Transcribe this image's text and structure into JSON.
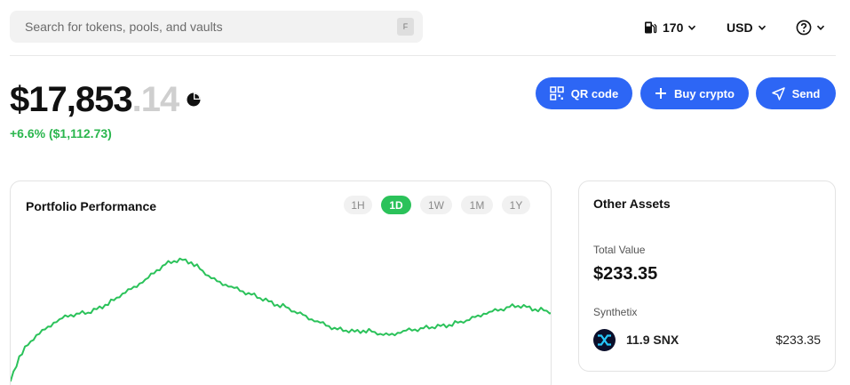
{
  "search": {
    "placeholder": "Search for tokens, pools, and vaults",
    "shortcut": "F"
  },
  "header": {
    "gas_value": "170",
    "currency": "USD"
  },
  "balance": {
    "whole": "$17,853",
    "cents": ".14",
    "change": "+6.6% ($1,112.73)",
    "change_color": "#2bb64e"
  },
  "actions": {
    "qr_label": "QR code",
    "buy_label": "Buy crypto",
    "send_label": "Send",
    "button_color": "#2d66f5"
  },
  "performance": {
    "title": "Portfolio Performance",
    "tabs": [
      {
        "label": "1H",
        "active": false
      },
      {
        "label": "1D",
        "active": true
      },
      {
        "label": "1W",
        "active": false
      },
      {
        "label": "1M",
        "active": false
      },
      {
        "label": "1Y",
        "active": false
      }
    ],
    "series_values": [
      6,
      28,
      38,
      47,
      52,
      58,
      62,
      65,
      66,
      67,
      70,
      74,
      78,
      84,
      88,
      93,
      98,
      105,
      110,
      113,
      114,
      112,
      106,
      100,
      95,
      92,
      89,
      86,
      83,
      80,
      77,
      74,
      72,
      68,
      65,
      61,
      58,
      55,
      52,
      51,
      50,
      51,
      50,
      48,
      47,
      49,
      51,
      52,
      53,
      54,
      55,
      56,
      58,
      60,
      63,
      66,
      68,
      70,
      72,
      73,
      72,
      70,
      69,
      67
    ],
    "line_color": "#2bc25a"
  },
  "other_assets": {
    "title": "Other Assets",
    "total_label": "Total Value",
    "total_value": "$233.35",
    "group_label": "Synthetix",
    "asset": {
      "amount": "11.9 SNX",
      "value": "$233.35",
      "icon": "synthetix-icon"
    }
  }
}
